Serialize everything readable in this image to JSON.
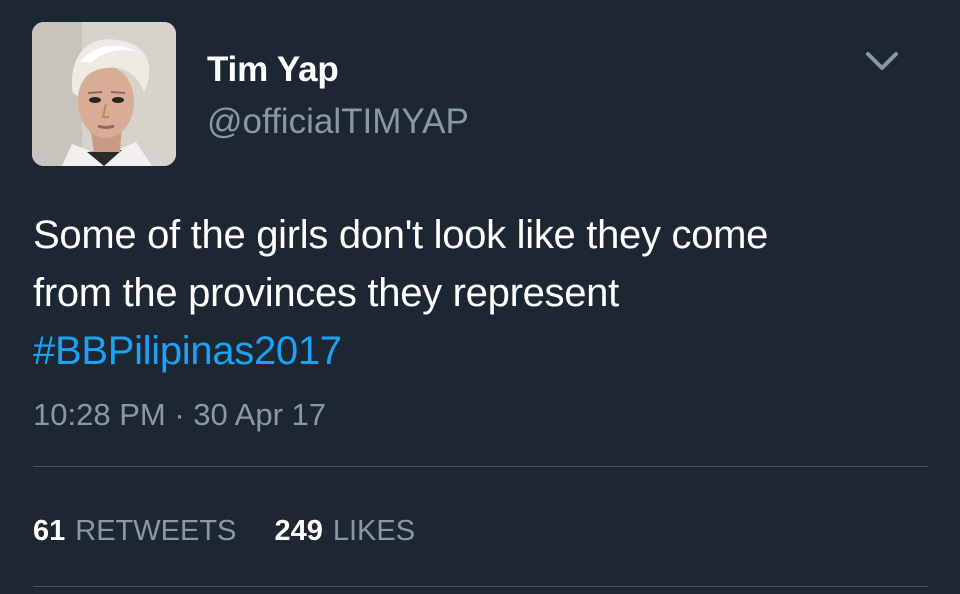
{
  "author": {
    "display_name": "Tim Yap",
    "handle": "@officialTIMYAP"
  },
  "tweet": {
    "text_lines": [
      "Some of the girls don't look like they come",
      "from the provinces they represent"
    ],
    "hashtag": "#BBPilipinas2017",
    "time": "10:28 PM",
    "separator": "·",
    "date": "30 Apr 17"
  },
  "stats": {
    "retweets_count": "61",
    "retweets_label": "RETWEETS",
    "likes_count": "249",
    "likes_label": "LIKES"
  },
  "icons": {
    "menu": "chevron-down-icon"
  },
  "colors": {
    "background": "#1c2733",
    "text": "#ffffff",
    "secondary_text": "#8899a6",
    "hashtag": "#1da1f2",
    "divider": "#3d5466"
  }
}
